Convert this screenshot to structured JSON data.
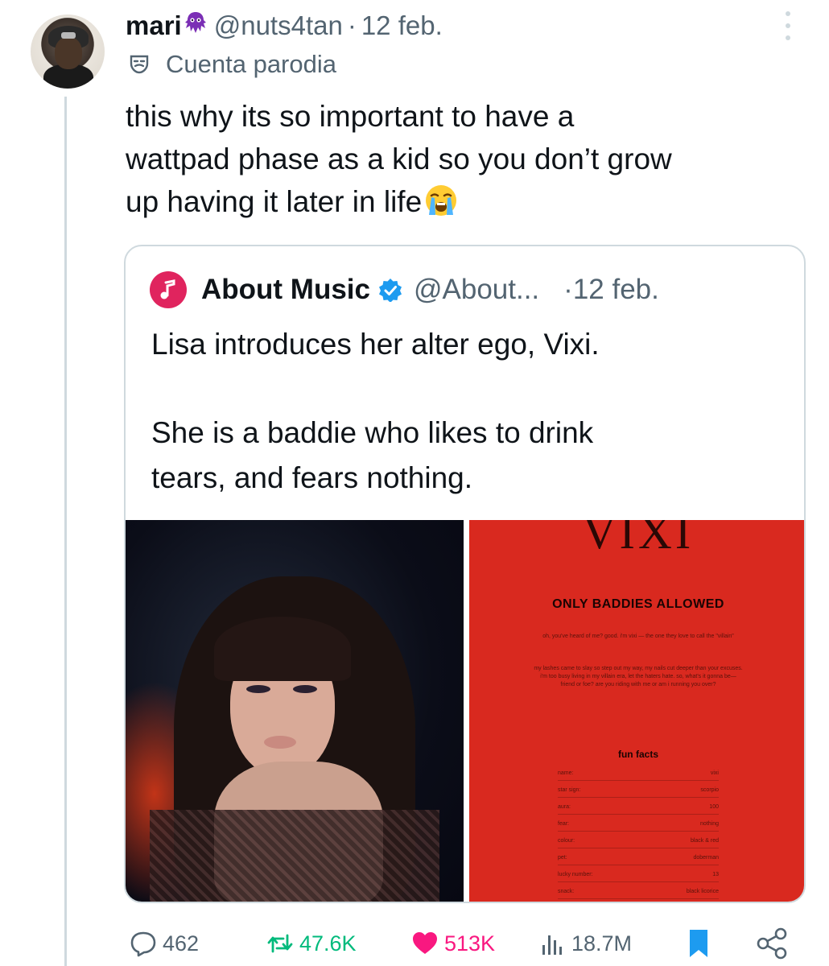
{
  "tweet": {
    "username": "mari",
    "username_emoji": "alien-monster-emoji",
    "handle": "@nuts4tan",
    "separator": "·",
    "time": "12 feb.",
    "parody_label": "Cuenta parodia",
    "text_lines": [
      "this why its so important to have a",
      "wattpad phase as a kid so you don’t grow",
      "up having it later in life"
    ],
    "trailing_emoji": "loudly-crying-face-emoji"
  },
  "quote": {
    "name": "About Music",
    "handle": "@About...",
    "separator": "·",
    "time": "12 feb.",
    "text_lines": [
      "Lisa introduces her alter ego, Vixi.",
      "",
      "She is a baddie who likes to drink",
      "tears, and fears nothing."
    ],
    "poster": {
      "title": "VIXI",
      "subtitle": "ONLY BADDIES ALLOWED",
      "intro": "oh, you've heard of me? good. i'm vixi — the one they love to call the \"villain\"",
      "paragraph": "my lashes came to slay so step out my way, my nails cut deeper than your excuses. i'm too busy living in my villain era, let the haters hate. so, what's it gonna be—friend or foe? are you riding with me or am i running you over?",
      "fun_facts_title": "fun facts",
      "facts": [
        {
          "k": "name:",
          "v": "vixi"
        },
        {
          "k": "star sign:",
          "v": "scorpio"
        },
        {
          "k": "aura:",
          "v": "100"
        },
        {
          "k": "fear:",
          "v": "nothing"
        },
        {
          "k": "colour:",
          "v": "black & red"
        },
        {
          "k": "pet:",
          "v": "doberman"
        },
        {
          "k": "lucky number:",
          "v": "13"
        },
        {
          "k": "snack:",
          "v": "black licorice"
        }
      ]
    }
  },
  "actions": {
    "replies": "462",
    "reposts": "47.6K",
    "likes": "513K",
    "views": "18.7M"
  },
  "colors": {
    "text": "#0f1419",
    "muted": "#536471",
    "verified": "#1d9bf0",
    "repost": "#00ba7c",
    "like": "#f91880",
    "bookmark": "#1d9bf0",
    "poster_red": "#d9291f"
  }
}
